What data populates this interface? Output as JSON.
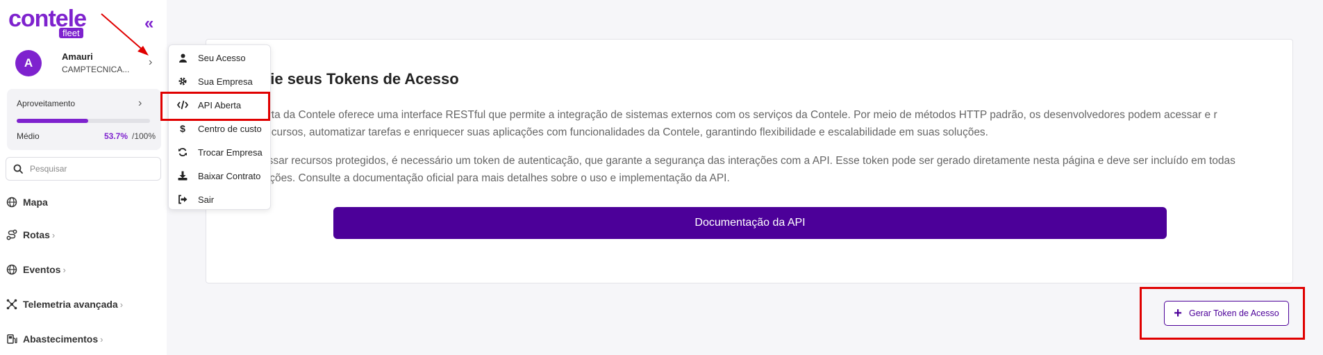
{
  "brand": {
    "name": "contele",
    "sub": "fleet",
    "accent": "#7e22ce"
  },
  "user": {
    "initial": "A",
    "name": "Amauri",
    "company": "CAMPTECNICA..."
  },
  "performance": {
    "title": "Aproveitamento",
    "level": "Médio",
    "percent_label": "53.7%",
    "total_label": "/100%",
    "percent": 53.7
  },
  "search": {
    "placeholder": "Pesquisar"
  },
  "nav": [
    {
      "label": "Mapa",
      "icon": "globe-icon",
      "has_sub": false
    },
    {
      "label": "Rotas",
      "icon": "route-icon",
      "has_sub": true
    },
    {
      "label": "Eventos",
      "icon": "globe-icon",
      "has_sub": true
    },
    {
      "label": "Telemetria avançada",
      "icon": "network-icon",
      "has_sub": true
    },
    {
      "label": "Abastecimentos",
      "icon": "fuel-icon",
      "has_sub": true
    }
  ],
  "menu": [
    {
      "label": "Seu Acesso",
      "icon": "user-icon"
    },
    {
      "label": "Sua Empresa",
      "icon": "gear-icon"
    },
    {
      "label": "API Aberta",
      "icon": "code-icon"
    },
    {
      "label": "Centro de custo",
      "icon": "dollar-icon"
    },
    {
      "label": "Trocar Empresa",
      "icon": "sync-icon"
    },
    {
      "label": "Baixar Contrato",
      "icon": "download-icon"
    },
    {
      "label": "Sair",
      "icon": "logout-icon"
    }
  ],
  "main": {
    "heading": "cie seus Tokens de Acesso",
    "para1": "erta da Contele oferece uma interface RESTful que permite a integração de sistemas externos com os serviços da Contele. Por meio de métodos HTTP padrão, os desenvolvedores podem acessar e r recursos, automatizar tarefas e enriquecer suas aplicações com funcionalidades da Contele, garantindo flexibilidade e escalabilidade em suas soluções.",
    "para2": "essar recursos protegidos, é necessário um token de autenticação, que garante a segurança das interações com a API. Esse token pode ser gerado diretamente nesta página e deve ser incluído em todas sições. Consulte a documentação oficial para mais detalhes sobre o uso e implementação da API.",
    "doc_button": "Documentação da API",
    "token_button": "Gerar Token de Acesso"
  },
  "colors": {
    "primary_dark": "#4c0099",
    "highlight": "#e00000"
  }
}
